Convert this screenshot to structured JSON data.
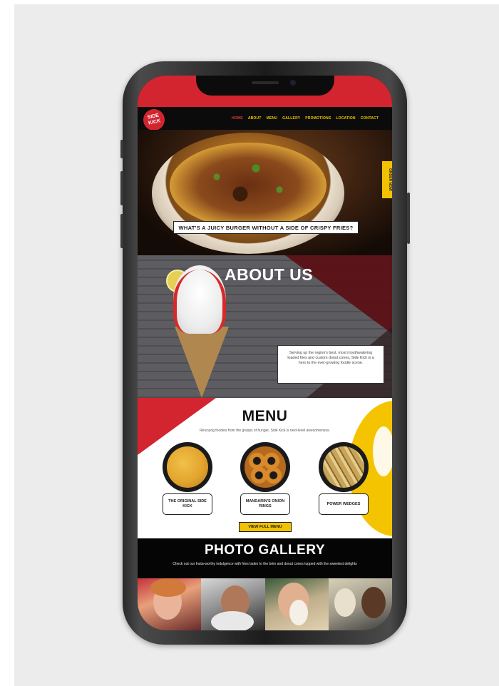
{
  "site": {
    "logo_text": "SIDE KICK",
    "nav": [
      "HOME",
      "ABOUT",
      "MENU",
      "GALLERY",
      "PROMOTIONS",
      "LOCATION",
      "CONTACT"
    ],
    "active_nav": "HOME",
    "order_tab": "ORDER NOW",
    "hero_caption": "WHAT'S A JUICY BURGER WITHOUT A SIDE OF CRISPY FRIES?",
    "about": {
      "title": "ABOUT US",
      "text": "Serving up the region's best, most mouthwatering loaded fries and custom donut cones, Side Kick is a hero to the ever-growing foodie scene."
    },
    "menu": {
      "title": "MENU",
      "subtitle": "Rescuing foodies from the grasps of hunger, Side Kick is next-level awesomeness.",
      "items": [
        {
          "label": "THE ORIGINAL SIDE KICK"
        },
        {
          "label": "MANDARIN'S ONION RINGS"
        },
        {
          "label": "POWER WEDGES"
        }
      ],
      "button": "VIEW FULL MENU"
    },
    "gallery": {
      "title": "PHOTO GALLERY",
      "subtitle": "Check out our Insta-worthy indulgence with fries laden to the brim and donut cones topped with the sweetest delights"
    }
  },
  "colors": {
    "brand_red": "#d32530",
    "brand_yellow": "#f2c200",
    "background_panel": "#ececec",
    "phone_body": "#1c1c1c"
  }
}
